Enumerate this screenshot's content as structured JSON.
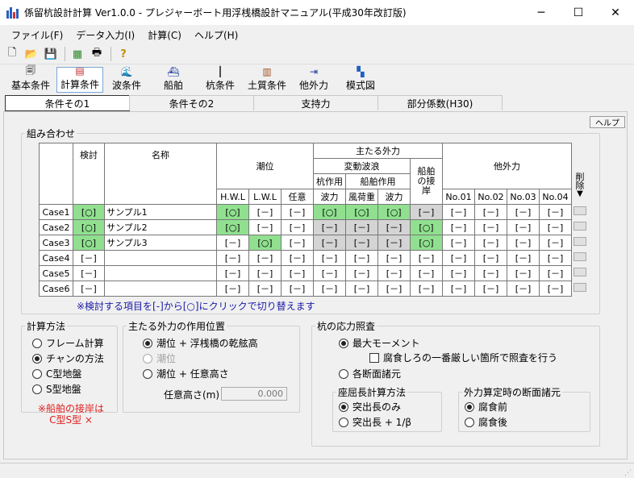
{
  "window": {
    "title": "係留杭設計計算 Ver1.0.0 - プレジャーボート用浮桟橋設計マニュアル(平成30年改訂版)"
  },
  "menu": [
    "ファイル(F)",
    "データ入力(I)",
    "計算(C)",
    "ヘルプ(H)"
  ],
  "toolbar_icons": [
    "new-file-icon",
    "open-folder-icon",
    "save-icon",
    "calculate-icon",
    "print-icon",
    "help-icon"
  ],
  "big_buttons": [
    "基本条件",
    "計算条件",
    "波条件",
    "船舶",
    "杭条件",
    "土質条件",
    "他外力",
    "模式図"
  ],
  "tabs": [
    "条件その1",
    "条件その2",
    "支持力",
    "部分係数(H30)"
  ],
  "help_label": "ヘルプ",
  "combo": {
    "legend": "組み合わせ",
    "h_check": "検討",
    "h_name": "名称",
    "h_tide": "潮位",
    "h_main": "主たる外力",
    "h_wave": "変動波浪",
    "h_pile": "杭作用",
    "h_ship": "船舶作用",
    "h_berth": "船舶の接岸",
    "h_other": "他外力",
    "h_del": "削除",
    "h_hwl": "H.W.L",
    "h_lwl": "L.W.L",
    "h_any": "任意",
    "h_wavef": "波力",
    "h_wind": "風荷重",
    "h_wavef2": "波力",
    "h_no1": "No.01",
    "h_no2": "No.02",
    "h_no3": "No.03",
    "h_no4": "No.04",
    "rows": [
      {
        "case": "Case1",
        "check": "[○]",
        "name": "サンプル1",
        "hwl": "[○]",
        "lwl": "[－]",
        "any": "[－]",
        "wave": "[○]",
        "wind": "[○]",
        "wave2": "[○]",
        "berth": "[－]",
        "no1": "[－]",
        "no2": "[－]",
        "no3": "[－]",
        "no4": "[－]"
      },
      {
        "case": "Case2",
        "check": "[○]",
        "name": "サンプル2",
        "hwl": "[○]",
        "lwl": "[－]",
        "any": "[－]",
        "wave": "[－]",
        "wind": "[－]",
        "wave2": "[－]",
        "berth": "[○]",
        "no1": "[－]",
        "no2": "[－]",
        "no3": "[－]",
        "no4": "[－]"
      },
      {
        "case": "Case3",
        "check": "[○]",
        "name": "サンプル3",
        "hwl": "[－]",
        "lwl": "[○]",
        "any": "[－]",
        "wave": "[－]",
        "wind": "[－]",
        "wave2": "[－]",
        "berth": "[○]",
        "no1": "[－]",
        "no2": "[－]",
        "no3": "[－]",
        "no4": "[－]"
      },
      {
        "case": "Case4",
        "check": "[－]",
        "name": "",
        "hwl": "[－]",
        "lwl": "[－]",
        "any": "[－]",
        "wave": "[－]",
        "wind": "[－]",
        "wave2": "[－]",
        "berth": "[－]",
        "no1": "[－]",
        "no2": "[－]",
        "no3": "[－]",
        "no4": "[－]"
      },
      {
        "case": "Case5",
        "check": "[－]",
        "name": "",
        "hwl": "[－]",
        "lwl": "[－]",
        "any": "[－]",
        "wave": "[－]",
        "wind": "[－]",
        "wave2": "[－]",
        "berth": "[－]",
        "no1": "[－]",
        "no2": "[－]",
        "no3": "[－]",
        "no4": "[－]"
      },
      {
        "case": "Case6",
        "check": "[－]",
        "name": "",
        "hwl": "[－]",
        "lwl": "[－]",
        "any": "[－]",
        "wave": "[－]",
        "wind": "[－]",
        "wave2": "[－]",
        "berth": "[－]",
        "no1": "[－]",
        "no2": "[－]",
        "no3": "[－]",
        "no4": "[－]"
      }
    ],
    "note": "※検討する項目を[-]から[○]にクリックで切り替えます"
  },
  "calc_method": {
    "legend": "計算方法",
    "options": [
      "フレーム計算",
      "チャンの方法",
      "C型地盤",
      "S型地盤"
    ],
    "selected": 1,
    "warning1": "※船舶の接岸は",
    "warning2": "C型S型 ×"
  },
  "force_position": {
    "legend": "主たる外力の作用位置",
    "options": [
      "潮位 + 浮桟橋の乾舷高",
      "潮位",
      "潮位 + 任意高さ"
    ],
    "selected": 0,
    "disabled": 1,
    "height_label": "任意高さ(m)",
    "height_value": "0.000"
  },
  "stress": {
    "legend": "杭の応力照査",
    "opt_max": "最大モーメント",
    "corrosion_check": "腐食しろの一番厳しい箇所で照査を行う",
    "opt_each": "各断面諸元",
    "buckling_legend": "座屈長計算方法",
    "buckling_opts": [
      "突出長のみ",
      "突出長 + 1/β"
    ],
    "buckling_selected": 0,
    "external_legend": "外力算定時の断面諸元",
    "external_opts": [
      "腐食前",
      "腐食後"
    ],
    "external_selected": 0
  },
  "colors": {
    "active_green": "#90e090",
    "disabled_gray": "#d4d4d4",
    "note_blue": "#1a1aa8",
    "warn_red": "#e02020"
  }
}
